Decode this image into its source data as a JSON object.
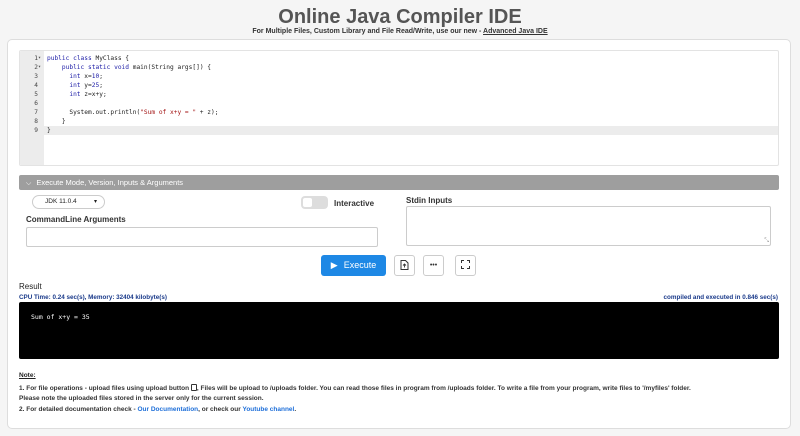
{
  "header": {
    "title": "Online Java Compiler IDE",
    "subtitle_prefix": "For Multiple Files, Custom Library and File Read/Write, use our new - ",
    "subtitle_link": "Advanced Java IDE"
  },
  "editor": {
    "lines": [
      {
        "num": "1",
        "fold": "▾",
        "code": "public class MyClass {"
      },
      {
        "num": "2",
        "fold": "▾",
        "code": "    public static void main(String args[]) {"
      },
      {
        "num": "3",
        "fold": "",
        "code": "      int x=10;"
      },
      {
        "num": "4",
        "fold": "",
        "code": "      int y=25;"
      },
      {
        "num": "5",
        "fold": "",
        "code": "      int z=x+y;"
      },
      {
        "num": "6",
        "fold": "",
        "code": ""
      },
      {
        "num": "7",
        "fold": "",
        "code": "      System.out.println(\"Sum of x+y = \" + z);"
      },
      {
        "num": "8",
        "fold": "",
        "code": "    }"
      },
      {
        "num": "9",
        "fold": "",
        "code": "}"
      }
    ],
    "active_line": 9
  },
  "execute_panel": {
    "header": "Execute Mode, Version, Inputs & Arguments",
    "jdk_version": "JDK 11.0.4",
    "interactive_label": "Interactive",
    "interactive_on": false,
    "cmd_label": "CommandLine Arguments",
    "stdin_label": "Stdin Inputs"
  },
  "actions": {
    "execute_label": "Execute",
    "more_label": "•••"
  },
  "result": {
    "label": "Result",
    "cpu": "CPU Time: 0.24 sec(s), Memory: 32404 kilobyte(s)",
    "compiled": "compiled and executed in 0.846 sec(s)",
    "output": "Sum of x+y = 35"
  },
  "notes": {
    "title": "Note:",
    "line1_a": "1. For file operations - upload files using upload button ",
    "line1_b": ", Files will be upload to /uploads folder. You can read those files in program from /uploads folder. To write a file from your program, write files to '/myfiles' folder.",
    "line2": "Please note the uploaded files stored in the server only for the current session.",
    "line3_a": "2. For detailed documentation check - ",
    "line3_link1": "Our Documentation",
    "line3_b": ", or check our ",
    "line3_link2": "Youtube channel",
    "line3_c": "."
  },
  "colors": {
    "execute_button": "#1e88e5",
    "panel_header": "#9e9e9e",
    "output_bg": "#000000",
    "link": "#1e6fd9",
    "stats": "#1a3a8a"
  }
}
